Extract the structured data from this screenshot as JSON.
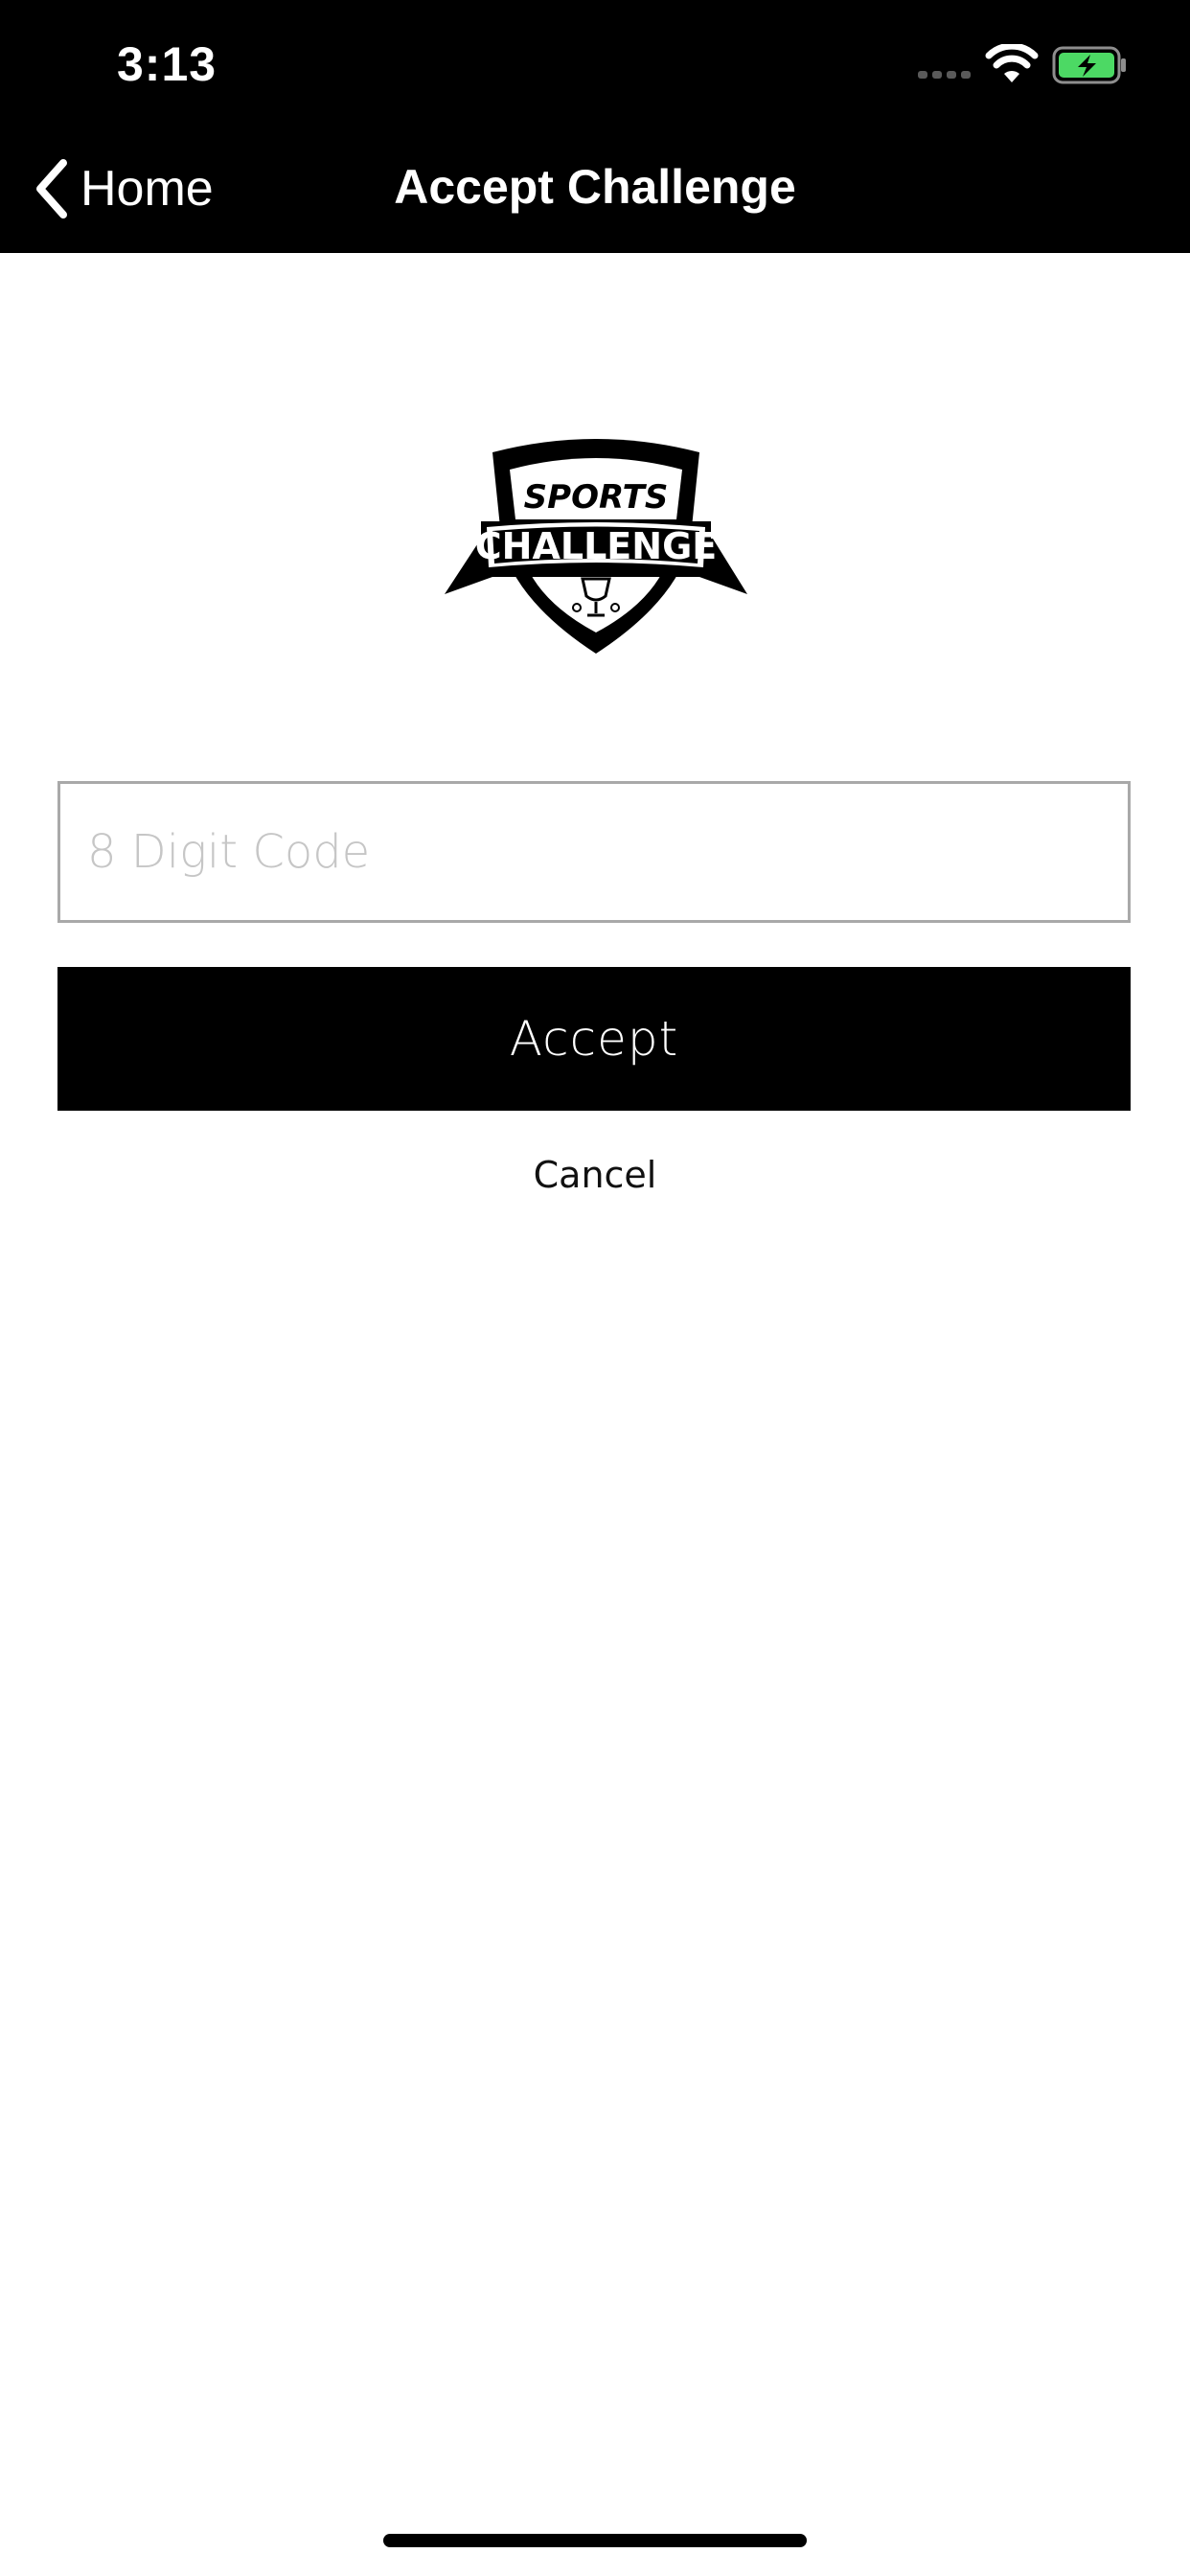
{
  "status_bar": {
    "time": "3:13",
    "signal_icon": "cellular-signal-icon",
    "wifi_icon": "wifi-icon",
    "battery_icon": "battery-charging-icon",
    "battery_color": "#4cd964"
  },
  "nav": {
    "back_label": "Home",
    "back_icon": "chevron-left-icon",
    "title": "Accept Challenge"
  },
  "logo": {
    "line1": "SPORTS",
    "line2": "CHALLENGE"
  },
  "form": {
    "code_placeholder": "8 Digit Code",
    "code_value": "",
    "accept_label": "Accept",
    "cancel_label": "Cancel"
  },
  "colors": {
    "bar_background": "#000000",
    "page_background": "#ffffff",
    "input_border": "#a9a9a9",
    "placeholder": "#c6c6c6"
  }
}
